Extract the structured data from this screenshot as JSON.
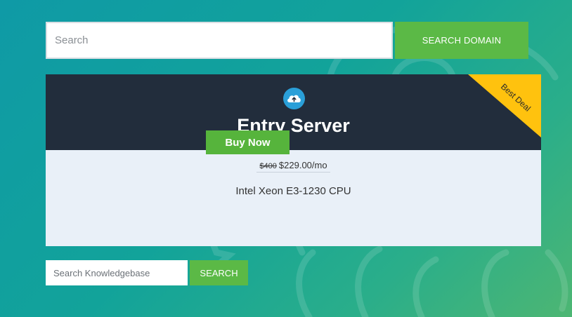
{
  "colors": {
    "accent_green": "#5bb946",
    "card_header": "#222d3c",
    "card_body": "#e9f0f8",
    "ribbon": "#ffc20e",
    "icon_blue": "#2a9fd8"
  },
  "domain_search": {
    "placeholder": "Search",
    "value": "",
    "button_label": "SEARCH DOMAIN"
  },
  "plan": {
    "icon": "cloud-upload-icon",
    "title": "Entry Server",
    "ribbon_label": "Best Deal",
    "old_price": "$400",
    "price": "$229.00/mo",
    "feature": "Intel Xeon E3-1230 CPU",
    "buy_label": "Buy Now"
  },
  "kb_search": {
    "placeholder": "Search Knowledgebase",
    "value": "",
    "button_label": "SEARCH"
  }
}
